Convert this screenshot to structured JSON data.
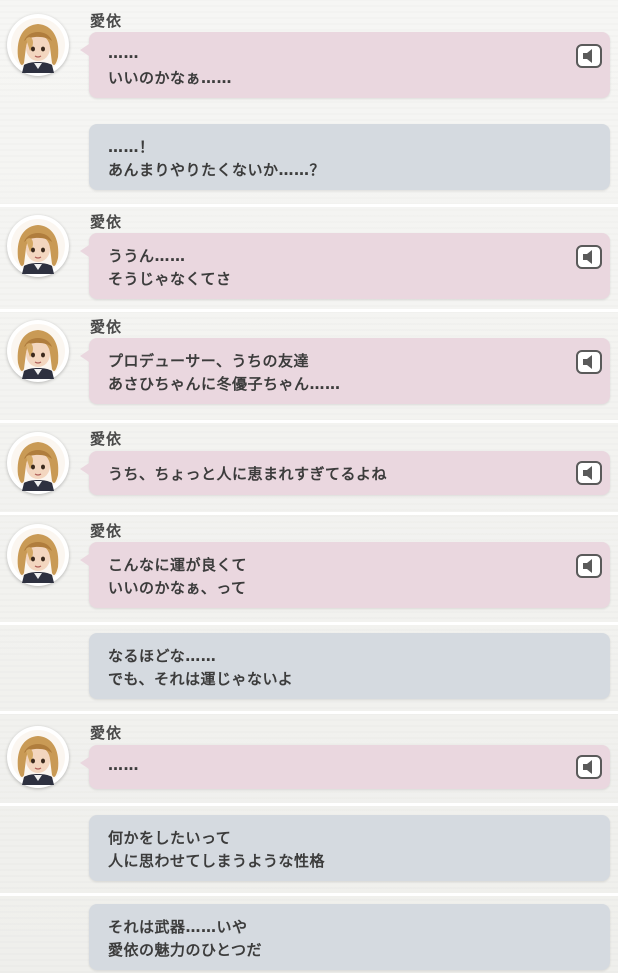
{
  "speaker_name": "愛依",
  "icons": {
    "avatar": "character-portrait-icon",
    "voice": "voice-playback-icon"
  },
  "colors": {
    "character_bubble": "#ead7df",
    "producer_bubble": "#d5dae0"
  },
  "messages": [
    {
      "kind": "character",
      "lines": [
        "……",
        "いいのかなぁ……"
      ]
    },
    {
      "kind": "producer",
      "lines": [
        "……！",
        "あんまりやりたくないか……？"
      ]
    },
    {
      "kind": "character",
      "lines": [
        "ううん……",
        "そうじゃなくてさ"
      ]
    },
    {
      "kind": "character",
      "lines": [
        "プロデューサー、うちの友達",
        "あさひちゃんに冬優子ちゃん……"
      ]
    },
    {
      "kind": "character",
      "lines": [
        "うち、ちょっと人に恵まれすぎてるよね"
      ]
    },
    {
      "kind": "character",
      "lines": [
        "こんなに運が良くて",
        "いいのかなぁ、って"
      ]
    },
    {
      "kind": "producer",
      "lines": [
        "なるほどな……",
        "でも、それは運じゃないよ"
      ]
    },
    {
      "kind": "character",
      "lines": [
        "……"
      ]
    },
    {
      "kind": "producer",
      "lines": [
        "何かをしたいって",
        "人に思わせてしまうような性格"
      ]
    },
    {
      "kind": "producer",
      "lines": [
        "それは武器……いや",
        "愛依の魅力のひとつだ"
      ]
    }
  ]
}
